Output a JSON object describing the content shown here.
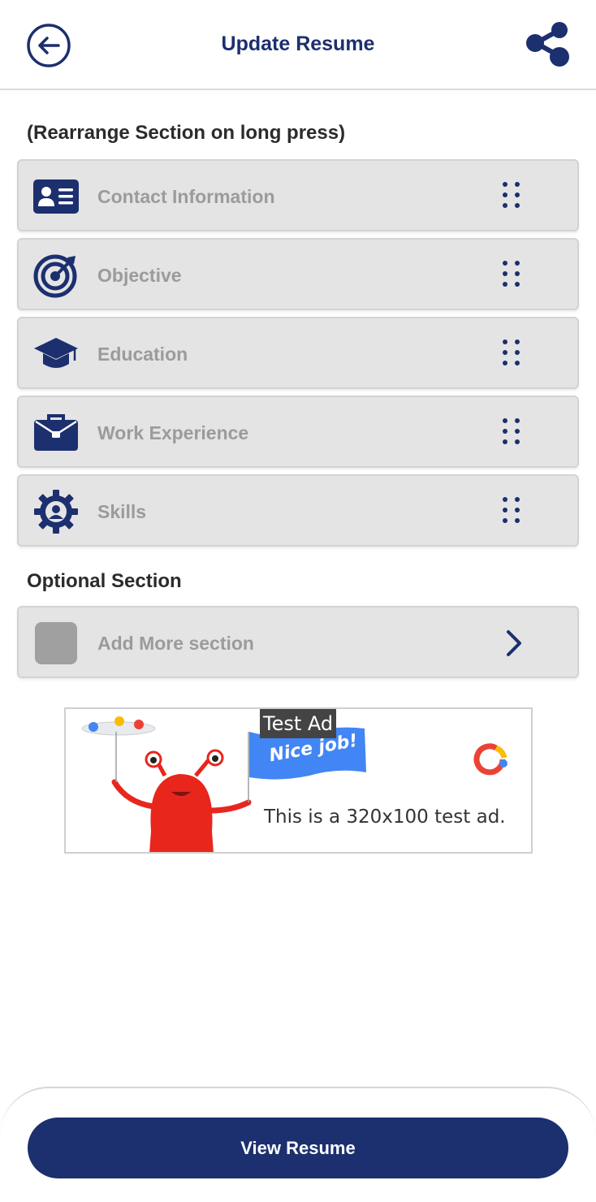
{
  "header": {
    "title": "Update Resume",
    "back_icon": "arrow-back-icon",
    "share_icon": "share-icon"
  },
  "main": {
    "rearrange_heading": "(Rearrange Section on long press)",
    "sections": [
      {
        "label": "Contact Information",
        "icon": "contact-card-icon"
      },
      {
        "label": "Objective",
        "icon": "target-icon"
      },
      {
        "label": "Education",
        "icon": "graduation-cap-icon"
      },
      {
        "label": "Work Experience",
        "icon": "briefcase-icon"
      },
      {
        "label": "Skills",
        "icon": "gear-user-icon"
      }
    ],
    "optional_heading": "Optional Section",
    "add_more": {
      "label": "Add More section",
      "icon": "placeholder-square-icon",
      "chevron": "chevron-right-icon"
    }
  },
  "ad": {
    "badge": "Test Ad",
    "banner_text": "Nice job!",
    "body_text": "This is a 320x100 test ad."
  },
  "footer": {
    "view_label": "View Resume"
  },
  "colors": {
    "primary": "#1c2f6e",
    "row_bg": "#e4e4e4",
    "label_gray": "#9b9b9b"
  }
}
